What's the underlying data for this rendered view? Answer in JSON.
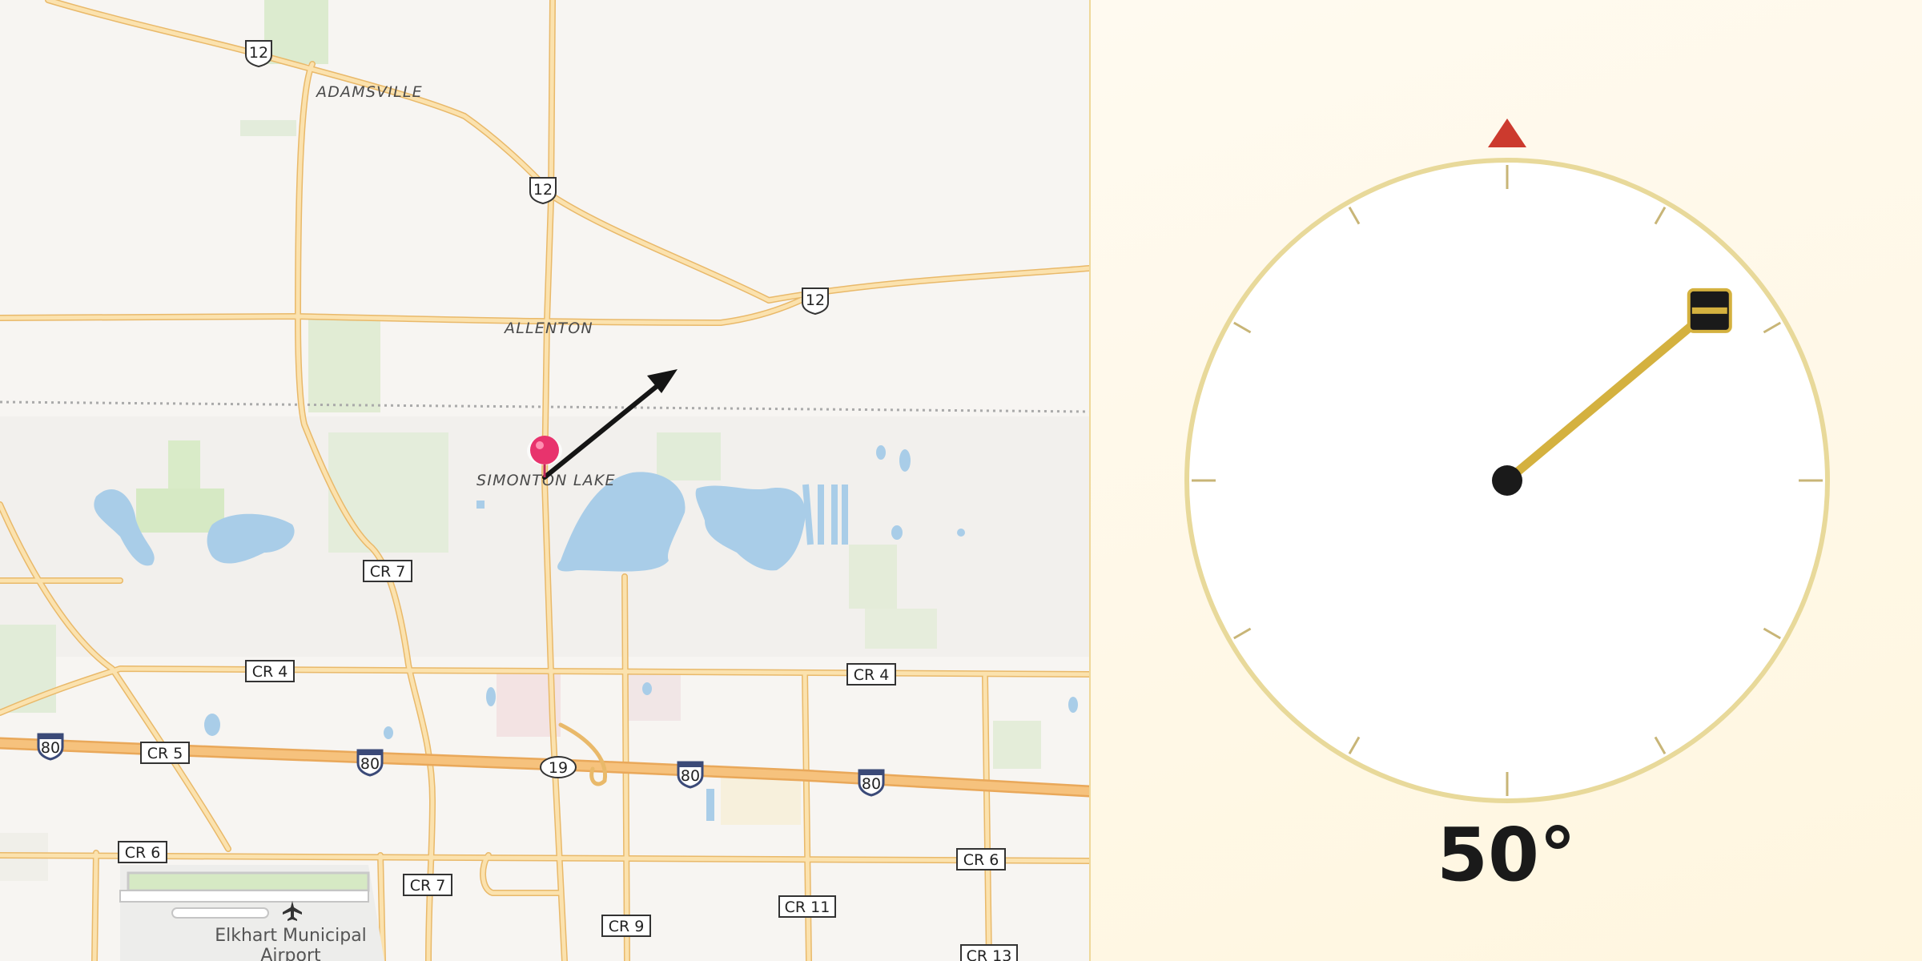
{
  "map": {
    "place_labels": {
      "adamsville": "ADAMSVILLE",
      "allenton": "ALLENTON",
      "simonton_lake": "SIMONTON LAKE"
    },
    "airport_label": [
      "Elkhart Municipal",
      "Airport"
    ],
    "us_route": "12",
    "interstate": "80",
    "state_route": "19",
    "county_roads": {
      "cr4": "CR 4",
      "cr5": "CR 5",
      "cr6": "CR 6",
      "cr7": "CR 7",
      "cr9": "CR 9",
      "cr11": "CR 11",
      "cr13": "CR 13"
    },
    "location_pin_icon": "map-pin-icon",
    "direction_arrow_icon": "direction-arrow-icon",
    "colors": {
      "road": "#f5c86a",
      "interstate": "#f0b25c",
      "water": "#a9cde8",
      "park": "#d9ecc6",
      "pin": "#e8336d"
    }
  },
  "compass": {
    "bearing_degrees": 50,
    "bearing_label": "50°",
    "north_marker_icon": "north-triangle-icon",
    "needle_color": "#d4b13f",
    "north_color": "#cc3a2e"
  }
}
